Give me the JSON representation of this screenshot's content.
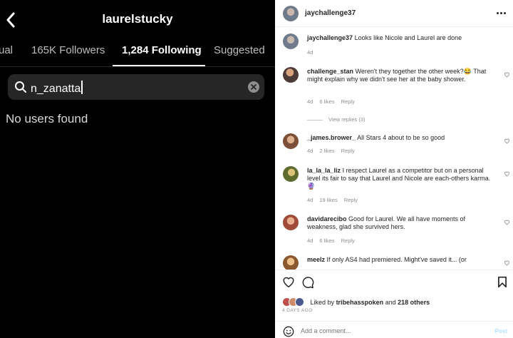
{
  "left": {
    "title": "laurelstucky",
    "tabs": [
      {
        "label": "ual"
      },
      {
        "label": "165K Followers"
      },
      {
        "label": "1,284 Following"
      },
      {
        "label": "Suggested"
      }
    ],
    "search": {
      "value": "n_zanatta"
    },
    "empty_message": "No users found"
  },
  "right": {
    "header": {
      "username": "jaychallenge37"
    },
    "comments": [
      {
        "user": "jaychallenge37",
        "text": "Looks like Nicole and Laurel are done",
        "time": "4d",
        "likes": "",
        "reply": ""
      },
      {
        "user": "challenge_stan",
        "text": "Weren't they together the other week?😂 That might explain why we didn't see her at the baby shower.",
        "time": "4d",
        "likes": "6 likes",
        "reply": "Reply"
      },
      {
        "user": "_james.brower_",
        "text": "All Stars 4 about to be so good",
        "time": "4d",
        "likes": "2 likes",
        "reply": "Reply"
      },
      {
        "user": "la_la_la_liz",
        "text": "I respect Laurel as a competitor but on a personal level its fair to say that Laurel and Nicole are each-others karma. 🔮",
        "time": "4d",
        "likes": "19 likes",
        "reply": "Reply"
      },
      {
        "user": "davidarecibo",
        "text": "Good for Laurel. We all have moments of weakness, glad she survived hers.",
        "time": "4d",
        "likes": "6 likes",
        "reply": "Reply"
      },
      {
        "user": "meelz",
        "text": "If only AS4 had premiered. Might've saved it... (or",
        "time": "",
        "likes": "",
        "reply": ""
      }
    ],
    "view_replies": "View replies (3)",
    "liked_by": {
      "prefix": "Liked by",
      "user": "tribehasspoken",
      "joiner": "and",
      "others": "218 others"
    },
    "timestamp": "4 DAYS AGO",
    "add_comment_placeholder": "Add a comment...",
    "post_label": "Post"
  },
  "colors": {
    "left_bg": "#000000",
    "search_bg": "#262626",
    "meta_gray": "#8e8e8e",
    "post_blue": "#b2dffc"
  },
  "icons": [
    "back-chevron-icon",
    "search-icon",
    "clear-icon",
    "more-icon",
    "heart-icon",
    "comment-icon",
    "bookmark-icon",
    "emoji-icon"
  ]
}
